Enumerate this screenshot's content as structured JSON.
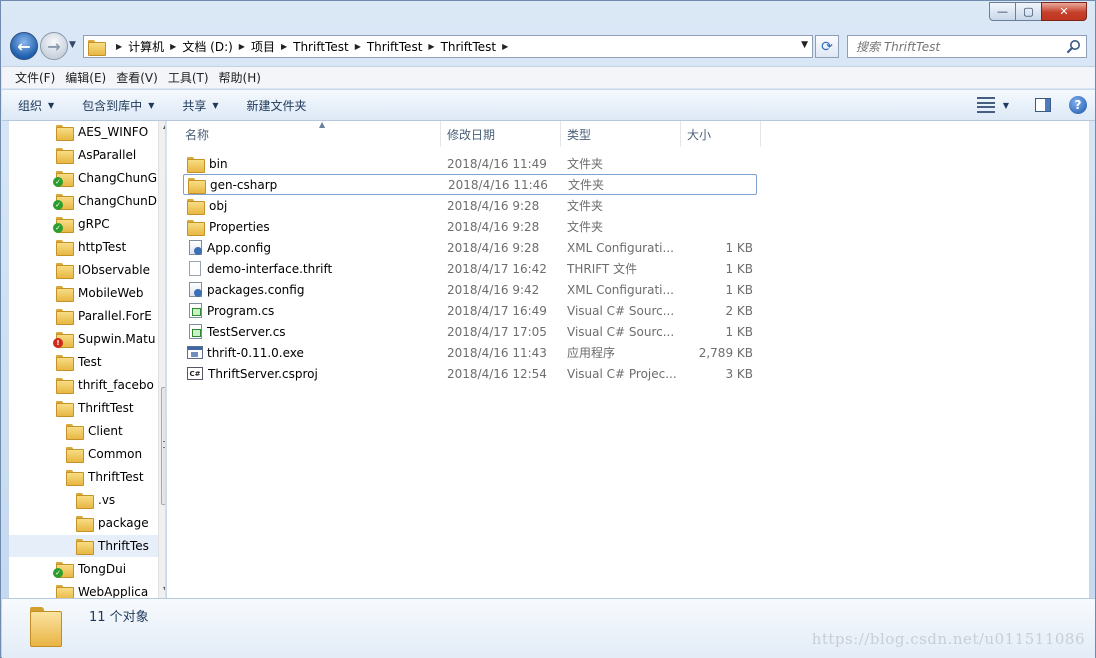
{
  "window": {
    "caption": {
      "minimize": "—",
      "maximize": "▢",
      "close": "✕"
    }
  },
  "nav": {
    "breadcrumbs": [
      "计算机",
      "文档 (D:)",
      "项目",
      "ThriftTest",
      "ThriftTest",
      "ThriftTest"
    ],
    "search_placeholder": "搜索 ThriftTest"
  },
  "menu": [
    "文件(F)",
    "编辑(E)",
    "查看(V)",
    "工具(T)",
    "帮助(H)"
  ],
  "toolbar": {
    "organize": "组织",
    "include_in_library": "包含到库中",
    "share": "共享",
    "new_folder": "新建文件夹"
  },
  "tree": [
    {
      "label": "AES_WINFO",
      "indent": 0,
      "badge": ""
    },
    {
      "label": "AsParallel",
      "indent": 0,
      "badge": ""
    },
    {
      "label": "ChangChunG",
      "indent": 0,
      "badge": "ok"
    },
    {
      "label": "ChangChunD",
      "indent": 0,
      "badge": "ok"
    },
    {
      "label": "gRPC",
      "indent": 0,
      "badge": "ok"
    },
    {
      "label": "httpTest",
      "indent": 0,
      "badge": ""
    },
    {
      "label": "IObservable",
      "indent": 0,
      "badge": ""
    },
    {
      "label": "MobileWeb",
      "indent": 0,
      "badge": ""
    },
    {
      "label": "Parallel.ForE",
      "indent": 0,
      "badge": ""
    },
    {
      "label": "Supwin.Matu",
      "indent": 0,
      "badge": "err"
    },
    {
      "label": "Test",
      "indent": 0,
      "badge": ""
    },
    {
      "label": "thrift_facebo",
      "indent": 0,
      "badge": ""
    },
    {
      "label": "ThriftTest",
      "indent": 0,
      "badge": ""
    },
    {
      "label": "Client",
      "indent": 1,
      "badge": ""
    },
    {
      "label": "Common",
      "indent": 1,
      "badge": ""
    },
    {
      "label": "ThriftTest",
      "indent": 1,
      "badge": ""
    },
    {
      "label": ".vs",
      "indent": 2,
      "badge": ""
    },
    {
      "label": "package",
      "indent": 2,
      "badge": ""
    },
    {
      "label": "ThriftTes",
      "indent": 2,
      "badge": "",
      "selected": true
    },
    {
      "label": "TongDui",
      "indent": 0,
      "badge": "ok"
    },
    {
      "label": "WebApplica",
      "indent": 0,
      "badge": ""
    }
  ],
  "columns": {
    "name": "名称",
    "date": "修改日期",
    "type": "类型",
    "size": "大小"
  },
  "files": [
    {
      "name": "bin",
      "date": "2018/4/16 11:49",
      "type": "文件夹",
      "size": "",
      "icon": "folder"
    },
    {
      "name": "gen-csharp",
      "date": "2018/4/16 11:46",
      "type": "文件夹",
      "size": "",
      "icon": "folder",
      "focused": true
    },
    {
      "name": "obj",
      "date": "2018/4/16 9:28",
      "type": "文件夹",
      "size": "",
      "icon": "folder"
    },
    {
      "name": "Properties",
      "date": "2018/4/16 9:28",
      "type": "文件夹",
      "size": "",
      "icon": "folder"
    },
    {
      "name": "App.config",
      "date": "2018/4/16 9:28",
      "type": "XML Configurati...",
      "size": "1 KB",
      "icon": "cfg"
    },
    {
      "name": "demo-interface.thrift",
      "date": "2018/4/17 16:42",
      "type": "THRIFT 文件",
      "size": "1 KB",
      "icon": "doc"
    },
    {
      "name": "packages.config",
      "date": "2018/4/16 9:42",
      "type": "XML Configurati...",
      "size": "1 KB",
      "icon": "cfg"
    },
    {
      "name": "Program.cs",
      "date": "2018/4/17 16:49",
      "type": "Visual C# Sourc...",
      "size": "2 KB",
      "icon": "cs"
    },
    {
      "name": "TestServer.cs",
      "date": "2018/4/17 17:05",
      "type": "Visual C# Sourc...",
      "size": "1 KB",
      "icon": "cs"
    },
    {
      "name": "thrift-0.11.0.exe",
      "date": "2018/4/16 11:43",
      "type": "应用程序",
      "size": "2,789 KB",
      "icon": "exe"
    },
    {
      "name": "ThriftServer.csproj",
      "date": "2018/4/16 12:54",
      "type": "Visual C# Projec...",
      "size": "3 KB",
      "icon": "proj"
    }
  ],
  "status": {
    "count": "11 个对象"
  },
  "watermark": "https://blog.csdn.net/u011511086",
  "colors": {
    "accent": "#1f5fae",
    "selection": "#e6eef9",
    "focus_border": "#7da2ce"
  }
}
